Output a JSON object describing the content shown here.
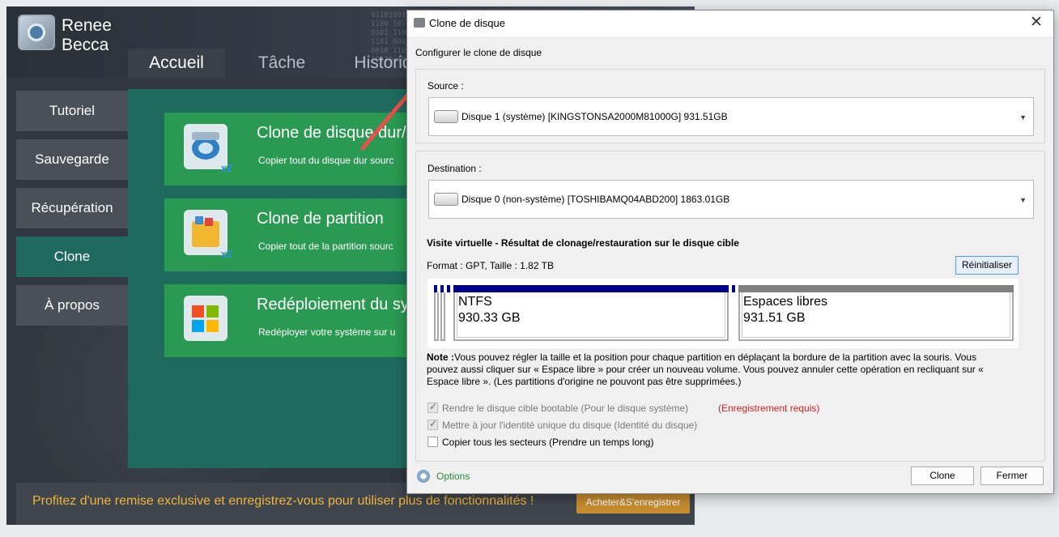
{
  "app": {
    "name_line1": "Renee",
    "name_line2": "Becca",
    "tabs": [
      {
        "label": "Accueil",
        "active": true
      },
      {
        "label": "Tâche",
        "active": false
      },
      {
        "label": "Historiq",
        "active": false
      }
    ],
    "sidebar": [
      {
        "label": "Tutoriel",
        "active": false
      },
      {
        "label": "Sauvegarde",
        "active": false
      },
      {
        "label": "Récupération",
        "active": false
      },
      {
        "label": "Clone",
        "active": true
      },
      {
        "label": "À propos",
        "active": false
      }
    ],
    "features": [
      {
        "title": "Clone de disque dur/",
        "desc": "Copier tout du disque dur sourc",
        "icon": "disk-clone-icon"
      },
      {
        "title": "Clone de partition",
        "desc": "Copier tout de la partition sourc",
        "icon": "partition-clone-icon"
      },
      {
        "title": "Redéploiement du sy",
        "desc": "Redéployer votre système sur u",
        "icon": "windows-logo-icon"
      }
    ],
    "promo_text": "Profitez d'une remise exclusive et enregistrez-vous pour utiliser plus de fonctionnalités !",
    "promo_button": "Acheter&S'enregistrer"
  },
  "dialog": {
    "title": "Clone de disque",
    "subtitle": "Configurer le clone de disque",
    "source_label": "Source :",
    "source_value": "Disque 1 (système) [KINGSTONSA2000M81000G]   931.51GB",
    "destination_label": "Destination :",
    "destination_value": "Disque 0 (non-système) [TOSHIBAMQ04ABD200]   1863.01GB",
    "virtual_title": "Visite virtuelle - Résultat de clonage/restauration sur le disque cible",
    "format_text": "Format : GPT,  Taille : 1.82 TB",
    "reset_button": "Réinitialiser",
    "partitions": [
      {
        "name": "NTFS",
        "size": "930.33 GB",
        "color": "#00008b"
      },
      {
        "name": "Espaces libres",
        "size": "931.51 GB",
        "color": "#808080"
      }
    ],
    "note_label": "Note :",
    "note_text": "Vous pouvez régler la taille et la position pour chaque partition en déplaçant la bordure de la partition avec la souris. Vous pouvez aussi cliquer sur « Espace libre » pour créer un nouveau volume. Vous pouvez annuler cette opération en recliquant sur « Espace libre ». (Les partitions d'origine ne pouvont pas être supprimées.)",
    "checkboxes": [
      {
        "label": "Rendre le disque cible bootable (Pour le disque système)",
        "checked": true,
        "disabled": true
      },
      {
        "label": "Mettre à jour l'identité unique du disque (Identité du disque)",
        "checked": true,
        "disabled": true
      },
      {
        "label": "Copier tous les secteurs (Prendre un temps long)",
        "checked": false,
        "disabled": false
      }
    ],
    "registration_required": "(Enregistrement requis)",
    "options_link": "Options",
    "clone_button": "Clone",
    "close_button": "Fermer"
  },
  "colors": {
    "accent_green": "#2a9a52",
    "panel_green": "#1e6b5d",
    "promo_text": "#f0b43c",
    "arrow": "#e8514a"
  }
}
